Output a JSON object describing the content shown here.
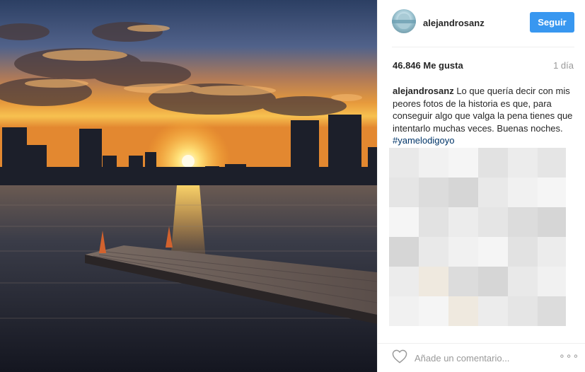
{
  "post": {
    "username": "alejandrosanz",
    "follow_label": "Seguir",
    "likes_label": "46.846 Me gusta",
    "time_label": "1 día",
    "caption": {
      "username": "alejandrosanz",
      "text": " Lo que quería decir con mis peores fotos de la historia es que, para conseguir algo que valga la pena tienes que intentarlo muchas veces. Buenas noches. ",
      "hashtag": "#yamelodigoyo"
    },
    "comment_placeholder": "Añade un comentario...",
    "more_label": "∘∘∘"
  },
  "icons": {
    "heart": "heart-icon",
    "more": "more-options-icon"
  },
  "colors": {
    "follow_button": "#3897f0",
    "hashtag": "#003569",
    "muted_text": "#999999"
  }
}
